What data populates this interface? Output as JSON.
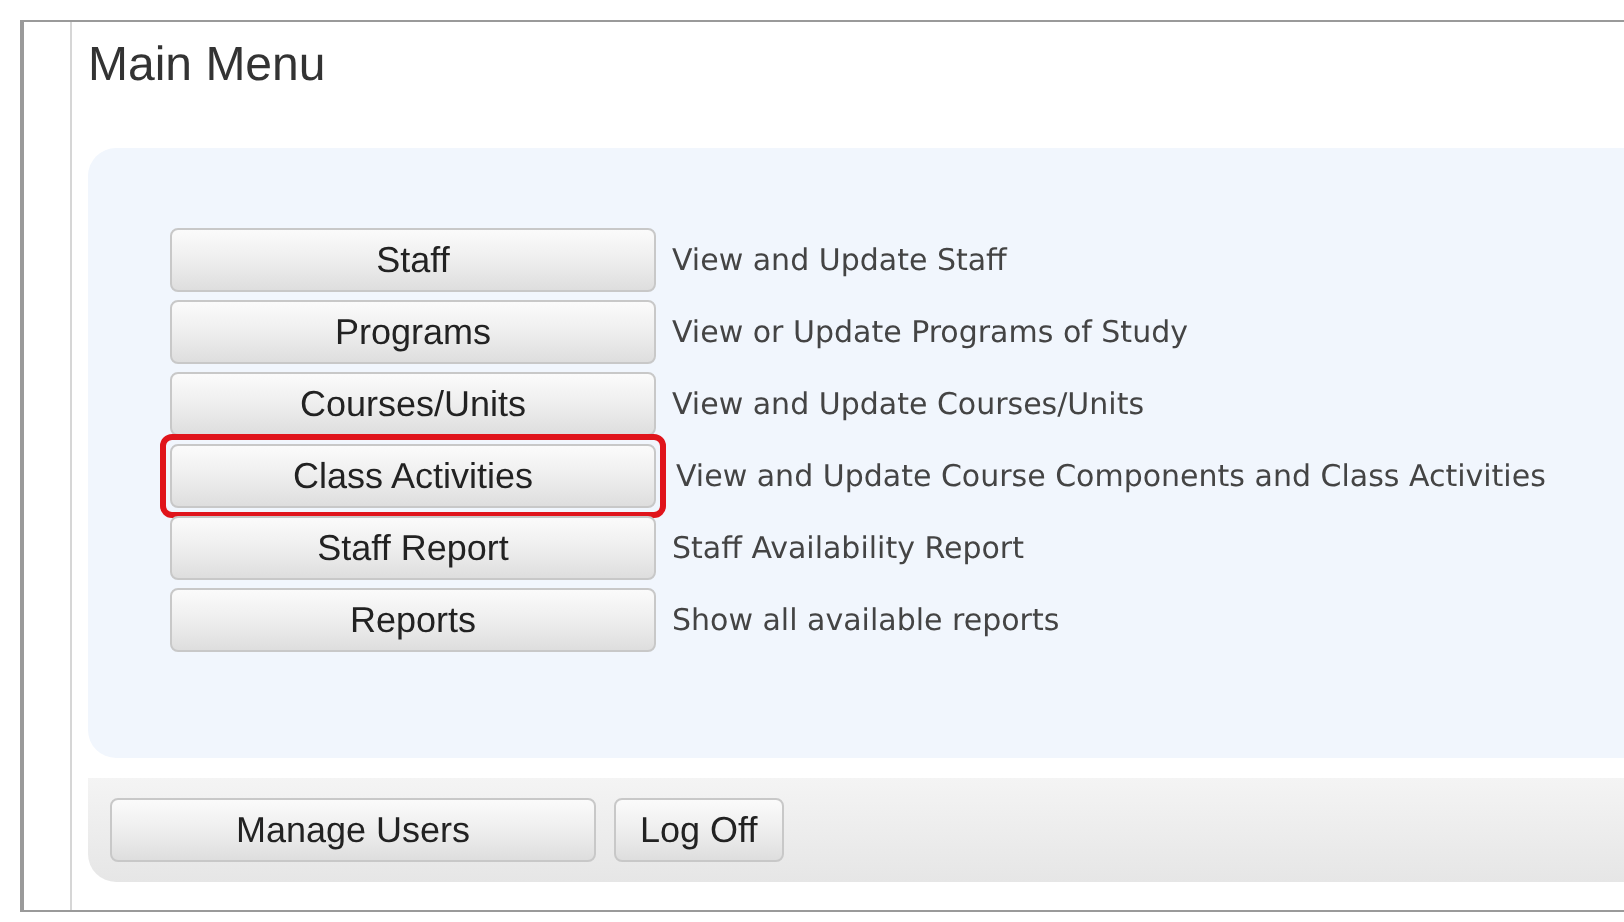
{
  "title": "Main Menu",
  "menu_items": [
    {
      "label": "Staff",
      "description": "View and Update Staff",
      "highlighted": false
    },
    {
      "label": "Programs",
      "description": "View or Update Programs of Study",
      "highlighted": false
    },
    {
      "label": "Courses/Units",
      "description": "View and Update Courses/Units",
      "highlighted": false
    },
    {
      "label": "Class Activities",
      "description": "View and Update Course Components and Class Activities",
      "highlighted": true
    },
    {
      "label": "Staff Report",
      "description": "Staff Availability Report",
      "highlighted": false
    },
    {
      "label": "Reports",
      "description": "Show all available reports",
      "highlighted": false
    }
  ],
  "footer_buttons": [
    {
      "label": "Manage Users",
      "kind": "wide"
    },
    {
      "label": "Log Off",
      "kind": "narrow"
    }
  ]
}
